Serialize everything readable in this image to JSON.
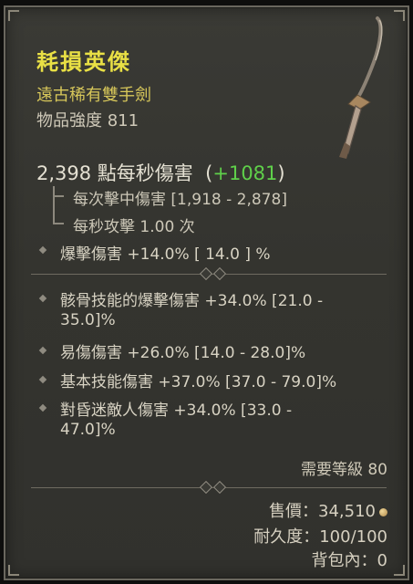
{
  "item": {
    "name": "耗損英傑",
    "rarity": "遠古稀有雙手劍",
    "power_label": "物品強度",
    "power_value": "811",
    "icon": "two-handed-sword-icon"
  },
  "damage": {
    "dps_text": "2,398 點每秒傷害",
    "dps_bonus": "+1081",
    "per_hit": "每次擊中傷害 [1,918 - 2,878]",
    "attack_speed": "每秒攻擊 1.00 次",
    "crit_damage": "爆擊傷害 +14.0%   [ 14.0 ] %"
  },
  "affixes": [
    {
      "line1": "骸骨技能的爆擊傷害 +34.0% [21.0 -",
      "line2": "35.0]%"
    },
    {
      "line1": "易傷傷害 +26.0% [14.0 - 28.0]%"
    },
    {
      "line1": "基本技能傷害 +37.0% [37.0 - 79.0]%"
    },
    {
      "line1": "對昏迷敵人傷害 +34.0% [33.0 -",
      "line2": "47.0]%"
    }
  ],
  "requirement": "需要等級 80",
  "footer": {
    "sell_price": "售價：34,510",
    "durability": "耐久度：100/100",
    "in_bag": "背包內：0"
  },
  "colors": {
    "name": "#e9e045",
    "rarity": "#d7c75a",
    "bonus": "#5fd04a"
  }
}
